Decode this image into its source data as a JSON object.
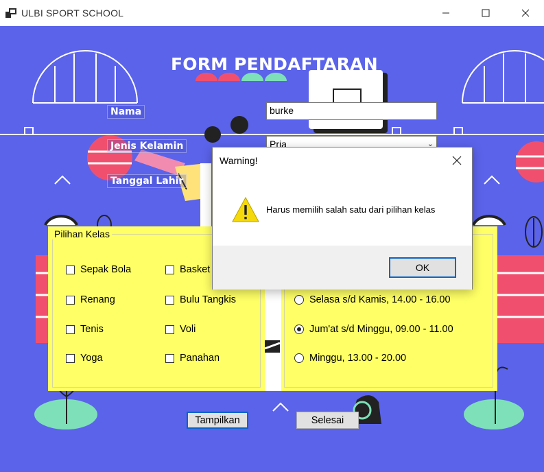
{
  "window": {
    "title": "ULBI SPORT SCHOOL",
    "controls": [
      "minimize-icon",
      "maximize-icon",
      "close-icon"
    ]
  },
  "form": {
    "title": "FORM PENDAFTARAN",
    "nama": {
      "label": "Nama",
      "value": "burke"
    },
    "jenis_kelamin": {
      "label": "Jenis Kelamin",
      "value": "Pria"
    },
    "tanggal_lahir": {
      "label": "Tanggal Lahir"
    }
  },
  "pilihan_kelas": {
    "title": "Pilihan Kelas",
    "options": [
      {
        "label": "Sepak Bola",
        "checked": false
      },
      {
        "label": "Basket",
        "checked": false
      },
      {
        "label": "Renang",
        "checked": false
      },
      {
        "label": "Bulu Tangkis",
        "checked": false
      },
      {
        "label": "Tenis",
        "checked": false
      },
      {
        "label": "Voli",
        "checked": false
      },
      {
        "label": "Yoga",
        "checked": false
      },
      {
        "label": "Panahan",
        "checked": false
      }
    ]
  },
  "jadwal": {
    "options": [
      {
        "label": "Selasa s/d Kamis, 14.00 - 16.00",
        "selected": false
      },
      {
        "label": "Jum'at s/d Minggu, 09.00 - 11.00",
        "selected": true
      },
      {
        "label": "Minggu, 13.00 - 20.00",
        "selected": false
      }
    ]
  },
  "buttons": {
    "tampilkan": "Tampilkan",
    "selesai": "Selesai"
  },
  "dialog": {
    "title": "Warning!",
    "icon": "warning-icon",
    "message": "Harus memilih salah satu dari pilihan kelas",
    "ok": "OK"
  },
  "colors": {
    "background": "#5b63ea",
    "panel": "#ffff66",
    "accent": "#0a64c8",
    "warning": "#f5d90a"
  }
}
